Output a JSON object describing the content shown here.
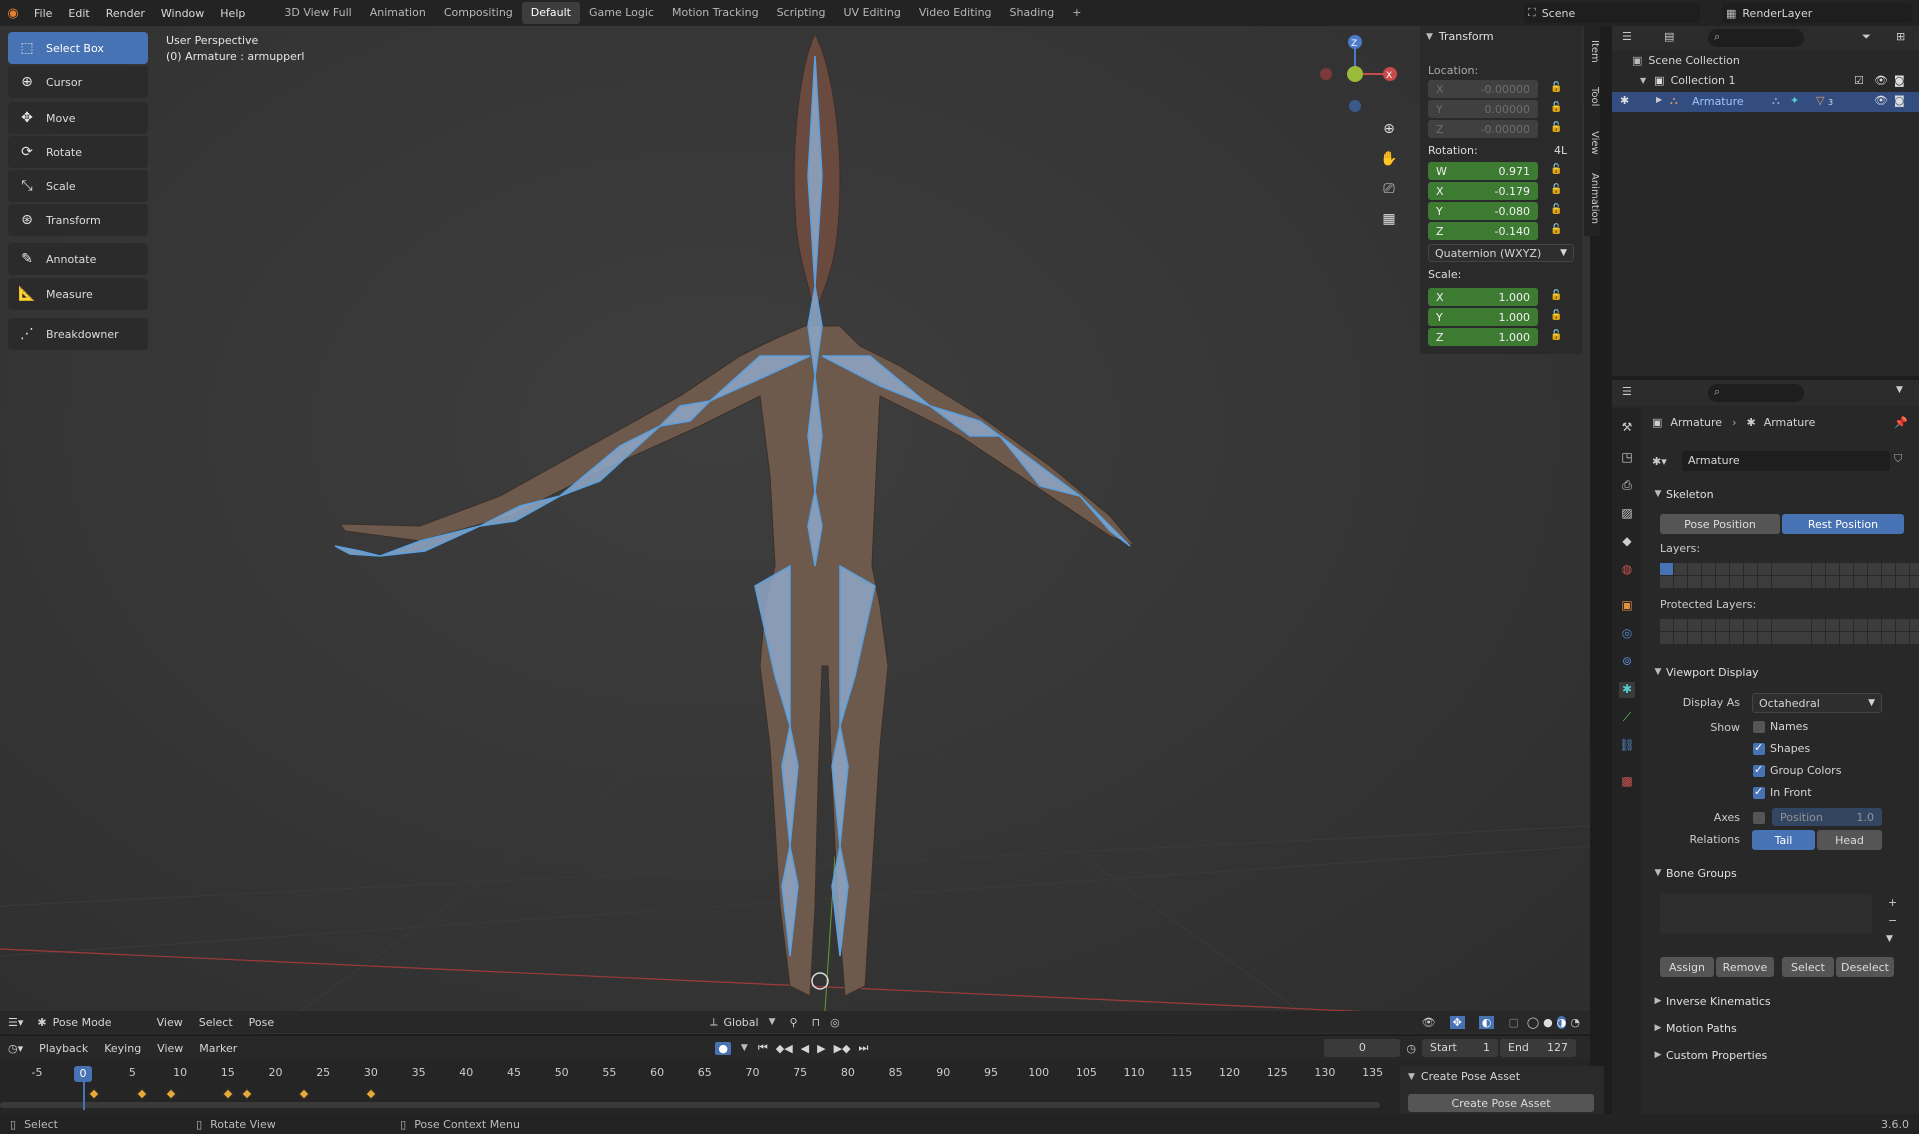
{
  "topbar": {
    "menus": [
      "File",
      "Edit",
      "Render",
      "Window",
      "Help"
    ],
    "workspaces": [
      "3D View Full",
      "Animation",
      "Compositing",
      "Default",
      "Game Logic",
      "Motion Tracking",
      "Scripting",
      "UV Editing",
      "Video Editing",
      "Shading",
      "+"
    ],
    "active_workspace": "Default",
    "scene": "Scene",
    "render_layer": "RenderLayer"
  },
  "tools": [
    {
      "label": "Select Box",
      "icon": "select-box-icon",
      "active": true
    },
    {
      "label": "Cursor",
      "icon": "cursor-icon"
    },
    {
      "label": "Move",
      "icon": "move-icon"
    },
    {
      "label": "Rotate",
      "icon": "rotate-icon"
    },
    {
      "label": "Scale",
      "icon": "scale-icon"
    },
    {
      "label": "Transform",
      "icon": "transform-icon"
    },
    {
      "label": "Annotate",
      "icon": "annotate-icon"
    },
    {
      "label": "Measure",
      "icon": "measure-icon"
    },
    {
      "label": "Breakdowner",
      "icon": "breakdowner-icon"
    }
  ],
  "viewport": {
    "perspective": "User Perspective",
    "object_info": "(0) Armature : armupperl"
  },
  "npanel": {
    "title": "Transform",
    "location_label": "Location:",
    "location": [
      {
        "axis": "X",
        "value": "-0.00000"
      },
      {
        "axis": "Y",
        "value": "0.00000"
      },
      {
        "axis": "Z",
        "value": "-0.00000"
      }
    ],
    "rotation_label": "Rotation:",
    "rotation_mode_short": "4L",
    "rotation": [
      {
        "axis": "W",
        "value": "0.971"
      },
      {
        "axis": "X",
        "value": "-0.179"
      },
      {
        "axis": "Y",
        "value": "-0.080"
      },
      {
        "axis": "Z",
        "value": "-0.140"
      }
    ],
    "rotation_mode": "Quaternion (WXYZ)",
    "scale_label": "Scale:",
    "scale": [
      {
        "axis": "X",
        "value": "1.000"
      },
      {
        "axis": "Y",
        "value": "1.000"
      },
      {
        "axis": "Z",
        "value": "1.000"
      }
    ],
    "tabs": [
      "Item",
      "Tool",
      "View",
      "Animation"
    ]
  },
  "outliner": {
    "scene_collection": "Scene Collection",
    "collection": "Collection 1",
    "armature": "Armature",
    "armature_badge": "3"
  },
  "properties": {
    "breadcrumb_1": "Armature",
    "breadcrumb_2": "Armature",
    "datablock_name": "Armature",
    "skeleton": {
      "title": "Skeleton",
      "pose_position": "Pose Position",
      "rest_position": "Rest Position",
      "layers_label": "Layers:",
      "protected_label": "Protected Layers:"
    },
    "viewport_display": {
      "title": "Viewport Display",
      "display_as_label": "Display As",
      "display_as": "Octahedral",
      "show_label": "Show",
      "names": "Names",
      "shapes": "Shapes",
      "group_colors": "Group Colors",
      "in_front": "In Front",
      "axes_label": "Axes",
      "axes_position": "Position",
      "axes_value": "1.0",
      "relations_label": "Relations",
      "tail": "Tail",
      "head": "Head"
    },
    "bone_groups": {
      "title": "Bone Groups",
      "assign": "Assign",
      "remove": "Remove",
      "select": "Select",
      "deselect": "Deselect"
    },
    "collapsed_panels": [
      "Inverse Kinematics",
      "Motion Paths",
      "Custom Properties"
    ]
  },
  "viewport_header": {
    "mode": "Pose Mode",
    "menus": [
      "View",
      "Select",
      "Pose"
    ],
    "orientation": "Global"
  },
  "timeline": {
    "menus": [
      "Playback",
      "Keying",
      "View",
      "Marker"
    ],
    "current_frame": "0",
    "start_label": "Start",
    "start": "1",
    "end_label": "End",
    "end": "127",
    "ticks": [
      "-5",
      "0",
      "5",
      "10",
      "15",
      "20",
      "25",
      "30",
      "35",
      "40",
      "45",
      "50",
      "55",
      "60",
      "65",
      "70",
      "75",
      "80",
      "85",
      "90",
      "95",
      "100",
      "105",
      "110",
      "115",
      "120",
      "125",
      "130",
      "135"
    ],
    "playhead": "0",
    "keyframes": [
      1,
      6,
      9,
      15,
      17,
      23,
      30
    ],
    "pose_asset_title": "Create Pose Asset",
    "pose_asset_button": "Create Pose Asset"
  },
  "statusbar": {
    "select": "Select",
    "rotate": "Rotate View",
    "context": "Pose Context Menu",
    "version": "3.6.0"
  },
  "colors": {
    "accent": "#4772b3",
    "green_field": "#3d7a32",
    "bone": "#8fa8c8",
    "bone_outline": "#5aa0e0",
    "keyframe": "#e8a83a"
  }
}
